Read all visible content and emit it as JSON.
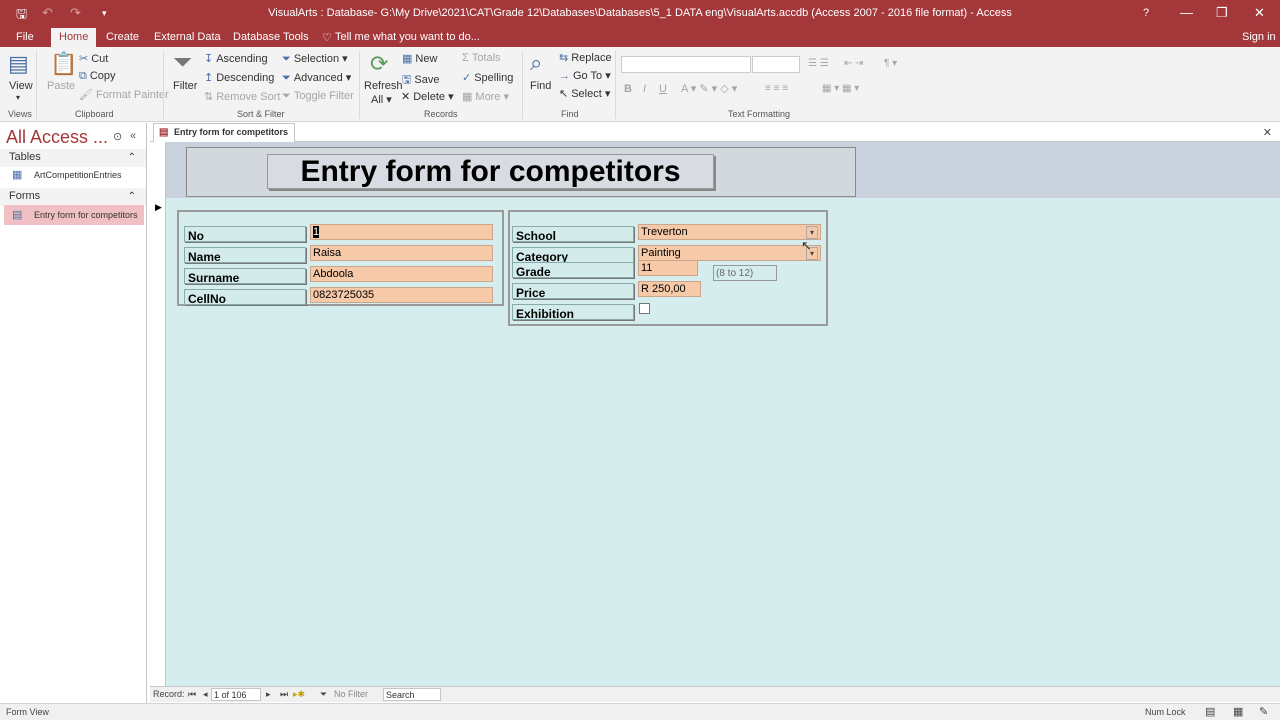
{
  "title": "VisualArts : Database- G:\\My Drive\\2021\\CAT\\Grade 12\\Databases\\Databases\\5_1 DATA eng\\VisualArts.accdb (Access 2007 - 2016 file format) - Access",
  "window_controls": [
    "?",
    "—",
    "❐",
    "✕"
  ],
  "tabs": [
    "File",
    "Home",
    "Create",
    "External Data",
    "Database Tools"
  ],
  "tell_me": "Tell me what you want to do...",
  "sign_in": "Sign in",
  "ribbon": {
    "views": {
      "view": "View",
      "group": "Views"
    },
    "clipboard": {
      "paste": "Paste",
      "cut": "Cut",
      "copy": "Copy",
      "format_painter": "Format Painter",
      "group": "Clipboard"
    },
    "sort_filter": {
      "filter": "Filter",
      "ascending": "Ascending",
      "descending": "Descending",
      "remove_sort": "Remove Sort",
      "selection": "Selection",
      "advanced": "Advanced",
      "toggle_filter": "Toggle Filter",
      "group": "Sort & Filter"
    },
    "records": {
      "refresh": "Refresh",
      "refresh_all": "All",
      "new": "New",
      "save": "Save",
      "delete": "Delete",
      "totals": "Totals",
      "spelling": "Spelling",
      "more": "More",
      "group": "Records"
    },
    "find": {
      "find": "Find",
      "replace": "Replace",
      "goto": "Go To",
      "select": "Select",
      "group": "Find"
    },
    "text_formatting": {
      "bold": "B",
      "italic": "I",
      "underline": "U",
      "group": "Text Formatting"
    }
  },
  "nav": {
    "title": "All Access ...",
    "sections": [
      {
        "label": "Tables",
        "items": [
          "ArtCompetitionEntries"
        ]
      },
      {
        "label": "Forms",
        "items": [
          "Entry form for competitors"
        ]
      }
    ]
  },
  "doc_tab": "Entry form for competitors",
  "form": {
    "title": "Entry form for competitors",
    "left": [
      {
        "label": "No",
        "value": "1"
      },
      {
        "label": "Name",
        "value": "Raisa"
      },
      {
        "label": "Surname",
        "value": "Abdoola"
      },
      {
        "label": "CellNo",
        "value": "0823725035"
      }
    ],
    "right": {
      "school": {
        "label": "School",
        "value": "Treverton"
      },
      "category": {
        "label": "Category",
        "value": "Painting"
      },
      "grade": {
        "label": "Grade",
        "value": "11",
        "hint": "(8 to 12)"
      },
      "price": {
        "label": "Price",
        "value": "R 250,00"
      },
      "exhibition": {
        "label": "Exhibition",
        "checked": false
      }
    }
  },
  "record_nav": {
    "label": "Record:",
    "position": "1 of 106",
    "filter": "No Filter",
    "search": "Search"
  },
  "status": {
    "left": "Form View",
    "right": "Num Lock"
  },
  "colors": {
    "accent": "#a4373a",
    "field_bg": "#f6c9a8",
    "form_bg": "#d6eded",
    "nav_selected": "#f0c0c5"
  }
}
